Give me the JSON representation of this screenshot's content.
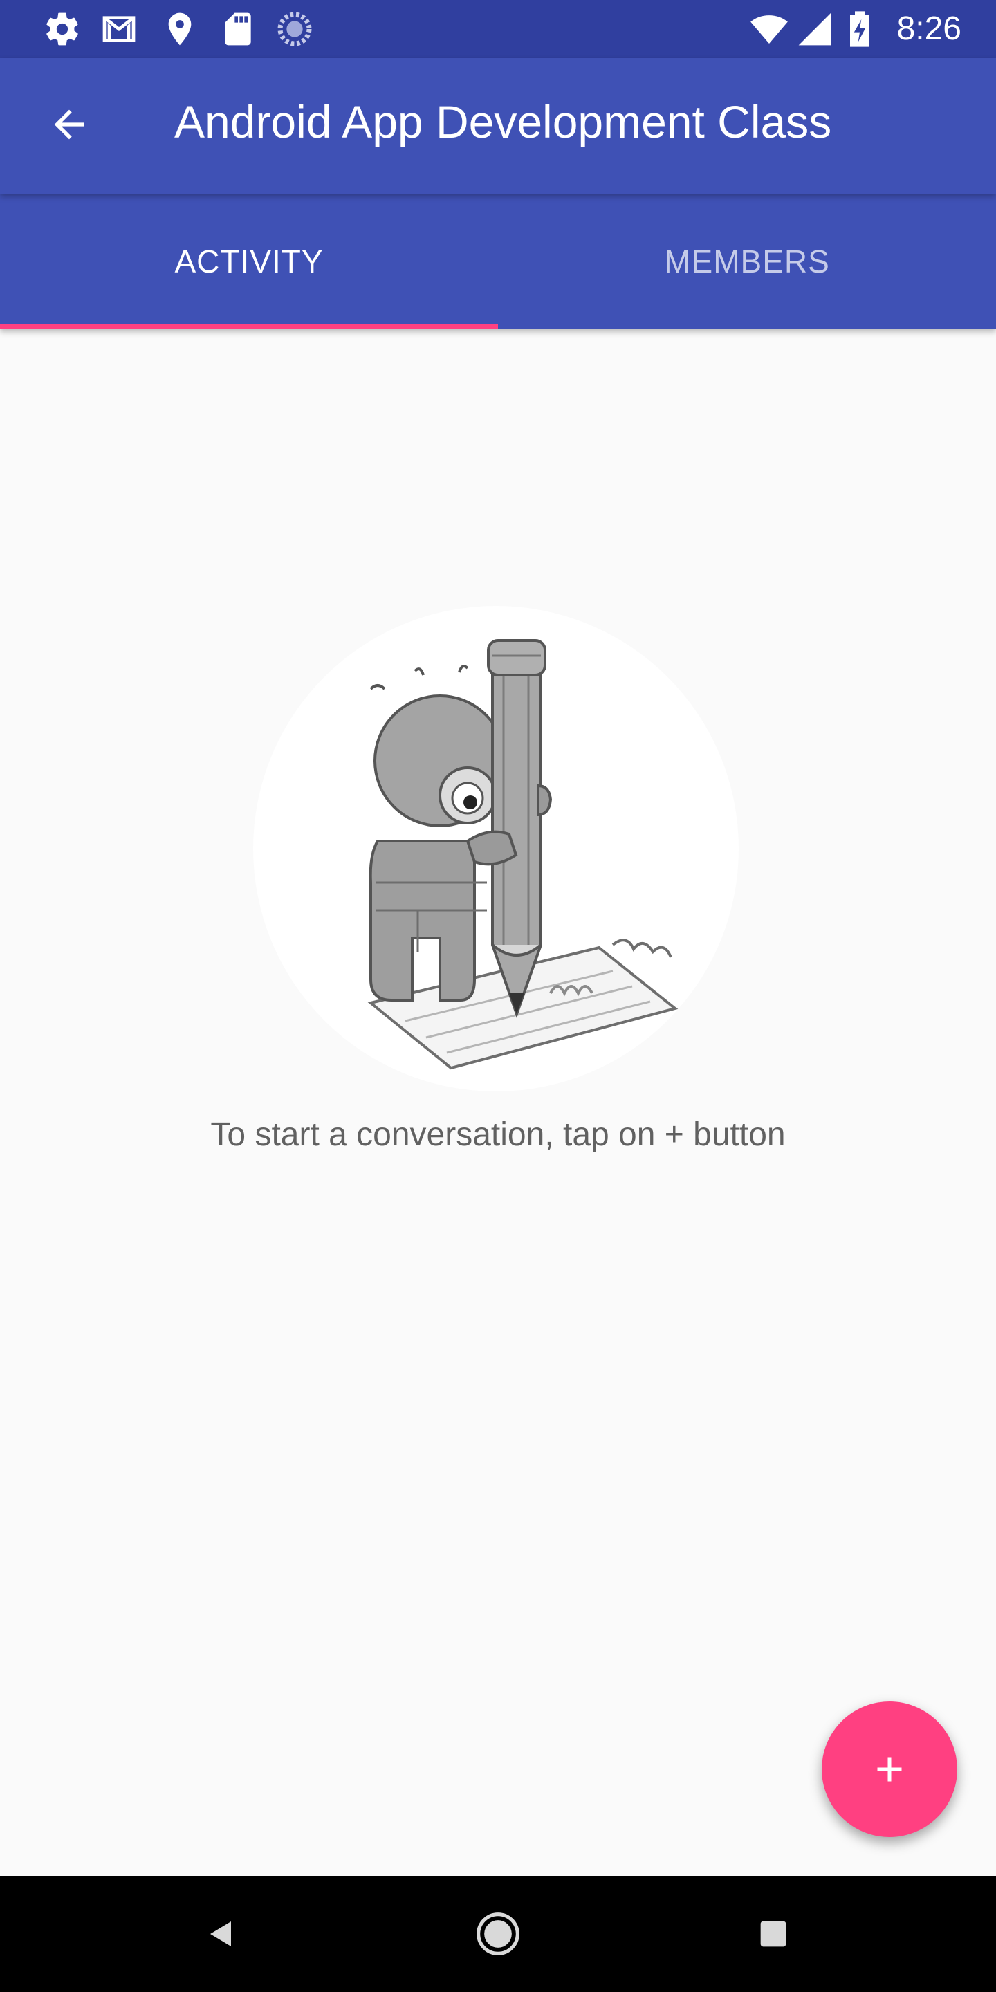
{
  "status_bar": {
    "time": "8:26",
    "left_icons": [
      "settings-icon",
      "gmail-icon",
      "location-icon",
      "sd-card-icon",
      "sync-icon"
    ],
    "right_icons": [
      "wifi-icon",
      "cell-signal-icon",
      "battery-charging-icon"
    ]
  },
  "app_bar": {
    "title": "Android App Development Class",
    "back_icon": "arrow-back-icon"
  },
  "tabs": [
    {
      "label": "ACTIVITY",
      "active": true
    },
    {
      "label": "MEMBERS",
      "active": false
    }
  ],
  "empty_state": {
    "message": "To start a conversation, tap on + button",
    "illustration": "character-with-pencil-illustration"
  },
  "fab": {
    "icon": "add-icon"
  },
  "nav_bar": {
    "icons": [
      "nav-back-icon",
      "nav-home-icon",
      "nav-recents-icon"
    ]
  },
  "colors": {
    "status_bar": "#303f9f",
    "primary": "#3f51b5",
    "accent": "#ff4081",
    "background": "#fafafa",
    "text_secondary": "#616161"
  }
}
